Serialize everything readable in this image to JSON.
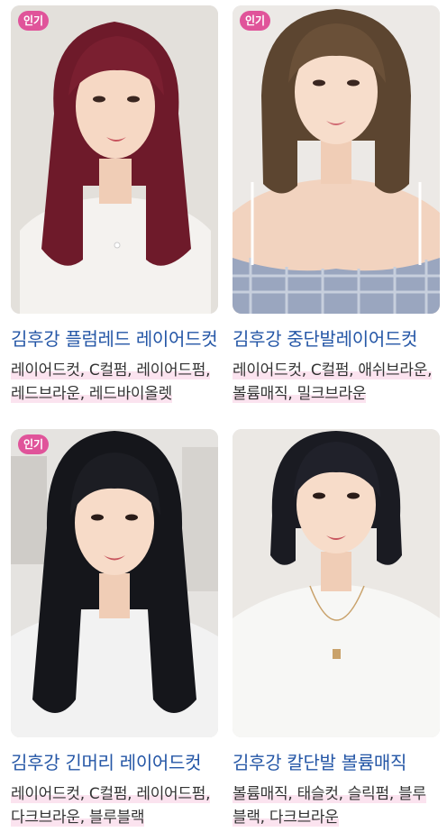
{
  "colors": {
    "badge": "#e0549a",
    "title": "#2456a6",
    "tags": "#333333",
    "tag_highlight": "#fbe3ef"
  },
  "cards": [
    {
      "badge": "인기",
      "title": "김후강 플럼레드 레이어드컷",
      "tags": "레이어드컷, C컬펌, 레이어드펌, 레드브라운, 레드바이올렛",
      "image": {
        "hair": "#6e1a2a",
        "top": "#f4f2ef",
        "bg": "#e9e6e2"
      }
    },
    {
      "badge": "인기",
      "title": "김후강 중단발레이어드컷",
      "tags": "레이어드컷, C컬펌, 애쉬브라운, 볼륨매직, 밀크브라운",
      "image": {
        "hair": "#5c4530",
        "top": "#9aa6bf",
        "bg": "#ece9e6"
      }
    },
    {
      "badge": "인기",
      "title": "김후강 긴머리 레이어드컷",
      "tags": "레이어드컷, C컬펌, 레이어드펌, 다크브라운, 블루블랙",
      "image": {
        "hair": "#15161b",
        "top": "#f2f2f2",
        "bg": "#e5e3e0"
      }
    },
    {
      "badge": "",
      "title": "김후강 칼단발 볼륨매직",
      "tags": "볼륨매직, 태슬컷, 슬릭펌, 블루블랙, 다크브라운",
      "image": {
        "hair": "#1a1b22",
        "top": "#f7f7f5",
        "bg": "#ebe8e4"
      }
    }
  ]
}
